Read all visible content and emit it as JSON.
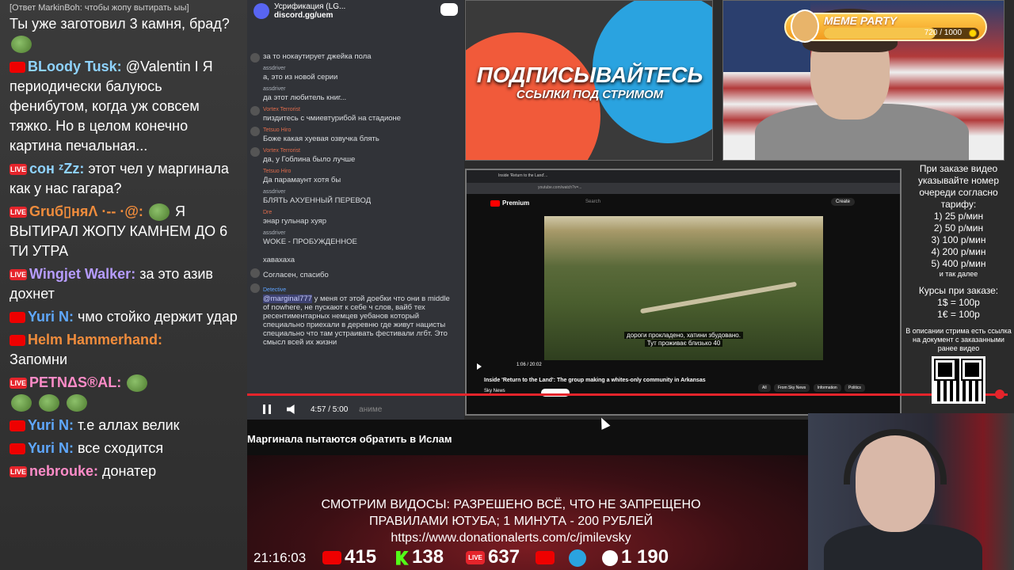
{
  "chat": {
    "reply_note": "[Ответ MarkinBoh: чтобы жопу вытирать ыы]",
    "messages": [
      {
        "author": "",
        "text": "Ты уже заготовил 3 камня, брад?"
      },
      {
        "author": "BLoody Tusk:",
        "text": "@Valentin I Я периодически балуюсь фенибутом, когда уж совсем тяжко. Но в целом конечно картина печальная..."
      },
      {
        "author": "сон ᶻZz:",
        "text": "этот чел у маргинала как у нас гагара?"
      },
      {
        "author": "Gruб▯няɅ ·-- ·@:",
        "text": "Я ВЫТИРАЛ ЖОПУ КАМНЕМ ДО 6 ТИ УТРА"
      },
      {
        "author": "Wingjet Walker:",
        "text": "за это азив дохнет"
      },
      {
        "author": "Yuri N:",
        "text": "чмо стойко держит удар"
      },
      {
        "author": "Helm Hammerhand:",
        "text": "Запомни"
      },
      {
        "author": "PETNΔS®AL:",
        "text": ""
      },
      {
        "author": "Yuri N:",
        "text": "т.е аллах велик"
      },
      {
        "author": "Yuri N:",
        "text": "все сходится"
      },
      {
        "author": "nebrouke:",
        "text": "донатер"
      }
    ]
  },
  "discord": {
    "server": "Усрификация (LG...",
    "link": "discord.gg/uem",
    "messages": [
      {
        "name": "",
        "text": "за то нокаутирует джейка пола"
      },
      {
        "name": "assdriver",
        "text": "а, это из новой серии"
      },
      {
        "name": "assdriver",
        "text": "да этот любитель книг..."
      },
      {
        "name": "Vortex Terrorist",
        "text": "пиздитесь с чмиевтурибой на стадионе"
      },
      {
        "name": "Tetsuo Hiro",
        "text": "Боже какая хуевая озвучка блять"
      },
      {
        "name": "Vortex Terrorist",
        "text": "да, у Гоблина было лучше"
      },
      {
        "name": "Tetsuo Hiro",
        "text": "Да парамаунт хотя бы"
      },
      {
        "name": "assdriver",
        "text": "БЛЯТЬ АХУЕННЫЙ ПЕРЕВОД"
      },
      {
        "name": "Dre",
        "text": "энар гульнар хуяр"
      },
      {
        "name": "assdriver",
        "text": "WOKE - ПРОБУЖДЕННОЕ"
      },
      {
        "name": "",
        "text": "хавахаха"
      },
      {
        "name": "",
        "text": "Согласен, спасибо"
      },
      {
        "name": "Detective",
        "mention": "@marginal777",
        "text": "у меня от этой доебки что они в middle of nowhere, не пускают к себе ч слов, вайб тех ресентиментарных немцев уебанов который специально приехали в деревню где живут нацисты специально что там устраивать фестивали лгбт. Это смысл всей их жизни"
      }
    ],
    "player_time": "4:57 / 5:00",
    "player_tail": "анимe"
  },
  "video_title": "Маргинала пытаются обратить в Ислам",
  "subscribe": {
    "big": "ПОДПИСЫВАЙТЕСЬ",
    "small": "ССЫЛКИ ПОД СТРИМОМ"
  },
  "meme": {
    "title": "MEME PARTY",
    "count": "720 / 1000",
    "progress": 0.72
  },
  "browser": {
    "tab": "Inside 'Return to the Land'...",
    "url": "youtube.com/watch?v=...",
    "logo": "Premium",
    "search": "Search",
    "create": "Create",
    "subtitle_line1": "дороги прокладено, хатини збудовано.",
    "subtitle_line2": "Тут проживає близько 40",
    "time": "1:06 / 20:02",
    "title": "Inside 'Return to the Land': The group making a whites-only community in Arkansas",
    "channel": "Sky News",
    "chips": [
      "All",
      "From Sky News",
      "Information",
      "Politics"
    ]
  },
  "prices": {
    "intro": "При заказе видео указывайте номер очереди согласно тарифу:",
    "tiers": [
      "1) 25 р/мин",
      "2) 50 р/мин",
      "3) 100 р/мин",
      "4) 200 р/мин",
      "5) 400 р/мин"
    ],
    "more": "и так далее",
    "rates_title": "Курсы при заказе:",
    "rates": [
      "1$ = 100р",
      "1€ = 100р"
    ],
    "note": "В описании стрима есть ссылка на документ с заказанными ранее видео"
  },
  "bottom": {
    "line1": "СМОТРИМ ВИДОСЫ: РАЗРЕШЕНО ВСЁ, ЧТО НЕ ЗАПРЕЩЕНО",
    "line2": "ПРАВИЛАМИ ЮТУБА; 1 МИНУТА - 200 РУБЛЕЙ",
    "url": "https://www.donationalerts.com/c/jmilevsky"
  },
  "stats": {
    "clock": "21:16:03",
    "youtube": "415",
    "kick": "138",
    "vk": "637",
    "total": "1 190",
    "vk_label": "LIVE"
  },
  "colors": {
    "accent_red": "#e5242b",
    "kick_green": "#53fc18",
    "telegram_blue": "#2aa3e0"
  }
}
